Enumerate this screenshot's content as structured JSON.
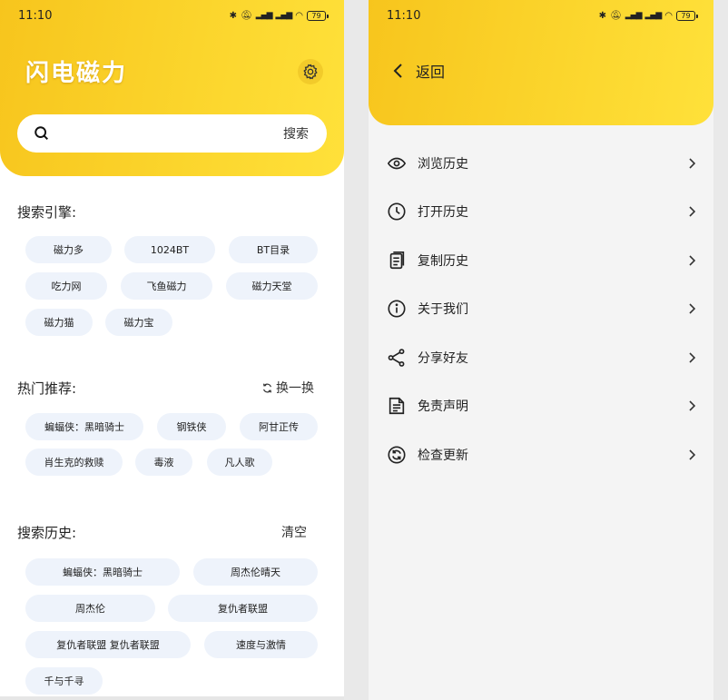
{
  "status": {
    "time": "11:10",
    "battery": "79"
  },
  "left": {
    "app_title": "闪电磁力",
    "search": {
      "placeholder": "",
      "button_label": "搜索"
    },
    "engines": {
      "title": "搜索引擎:",
      "items": [
        "磁力多",
        "1024BT",
        "BT目录",
        "吃力网",
        "飞鱼磁力",
        "磁力天堂",
        "磁力猫",
        "磁力宝"
      ]
    },
    "hot": {
      "title": "热门推荐:",
      "refresh_label": "换一换",
      "items": [
        "蝙蝠侠：黑暗骑士",
        "钢铁侠",
        "阿甘正传",
        "肖生克的救赎",
        "毒液",
        "凡人歌"
      ]
    },
    "history": {
      "title": "搜索历史:",
      "clear_label": "清空",
      "items": [
        "蝙蝠侠：黑暗骑士",
        "周杰伦晴天",
        "周杰伦",
        "复仇者联盟",
        "复仇者联盟 复仇者联盟",
        "速度与激情",
        "千与千寻"
      ]
    }
  },
  "right": {
    "back_label": "返回",
    "menu": [
      {
        "label": "浏览历史",
        "icon": "eye-icon"
      },
      {
        "label": "打开历史",
        "icon": "clock-icon"
      },
      {
        "label": "复制历史",
        "icon": "copy-icon"
      },
      {
        "label": "关于我们",
        "icon": "info-icon"
      },
      {
        "label": "分享好友",
        "icon": "share-icon"
      },
      {
        "label": "免责声明",
        "icon": "document-icon"
      },
      {
        "label": "检查更新",
        "icon": "refresh-icon"
      }
    ]
  },
  "colors": {
    "accent": "#fbd52c",
    "chip_bg": "#eef3fb",
    "panel_bg": "#f4f4f4"
  }
}
